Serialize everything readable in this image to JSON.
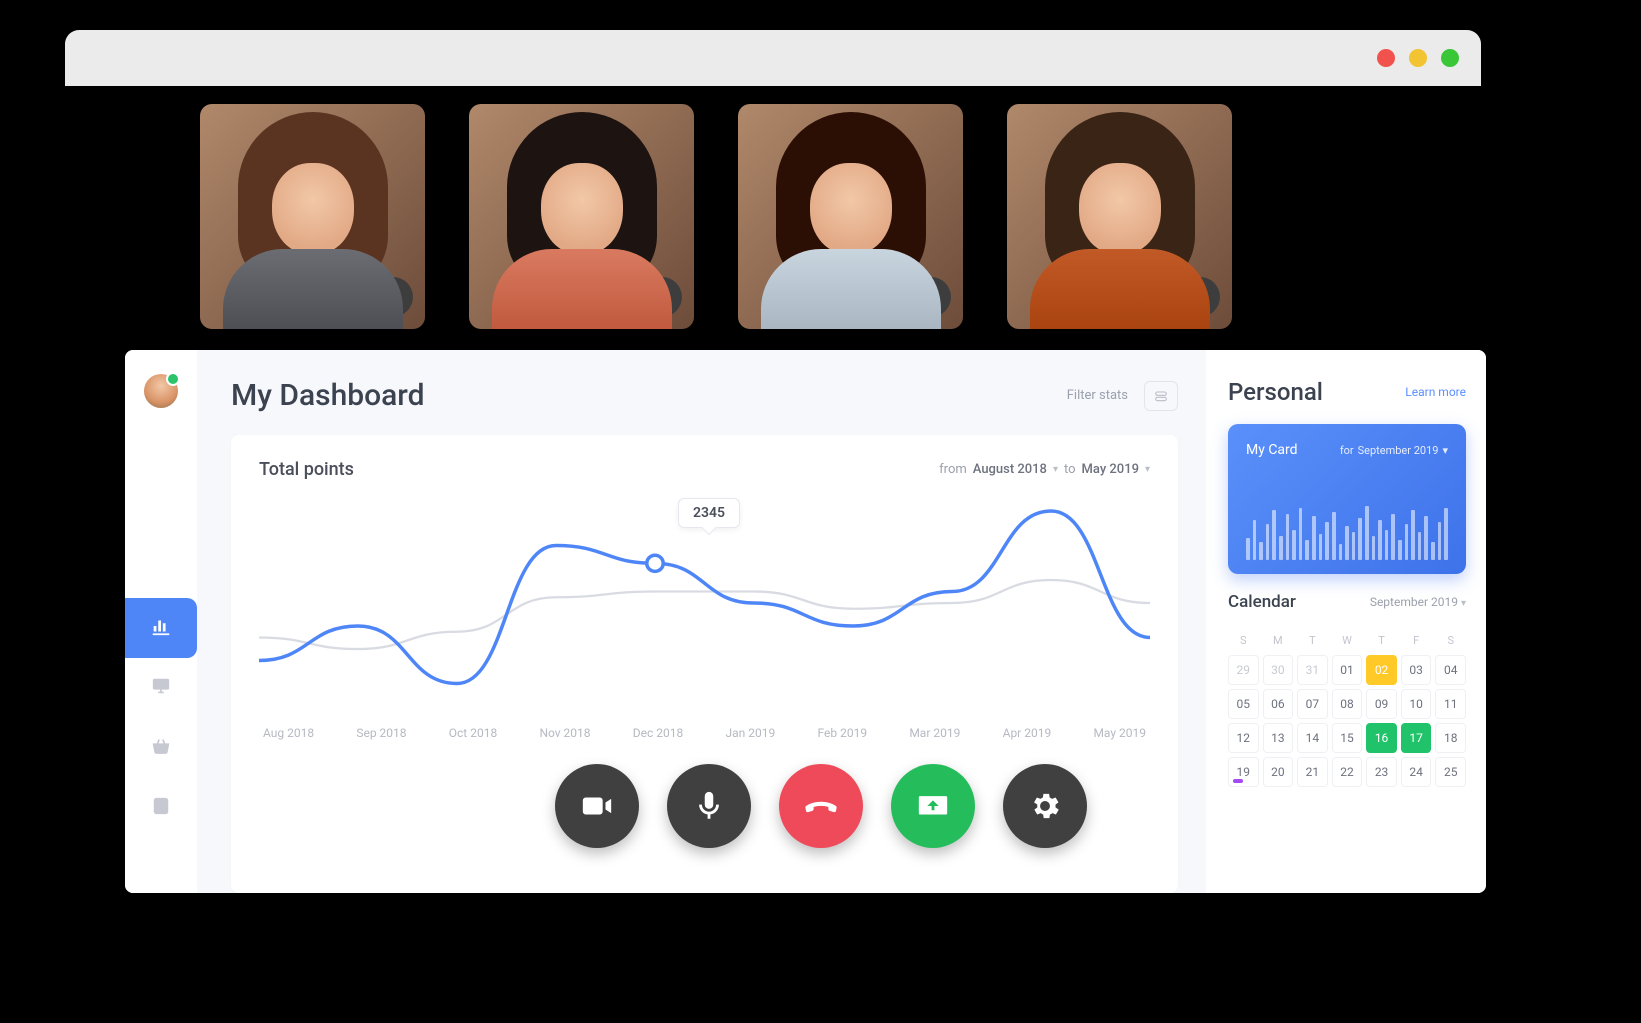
{
  "window": {
    "controls": [
      "close",
      "minimize",
      "maximize"
    ]
  },
  "participants": [
    {
      "name": "participant-1",
      "mic": "unmuted"
    },
    {
      "name": "participant-2",
      "mic": "unmuted"
    },
    {
      "name": "participant-3",
      "mic": "unmuted"
    },
    {
      "name": "participant-4",
      "mic": "unmuted"
    }
  ],
  "call_controls": {
    "video": "video-icon",
    "mic": "microphone-icon",
    "hangup": "phone-hangup-icon",
    "share": "screen-share-icon",
    "settings": "gear-icon"
  },
  "sidebar": {
    "items": [
      {
        "icon": "bar-chart-icon",
        "active": true
      },
      {
        "icon": "presentation-icon",
        "active": false
      },
      {
        "icon": "basket-icon",
        "active": false
      },
      {
        "icon": "note-icon",
        "active": false
      }
    ]
  },
  "dashboard": {
    "title": "My Dashboard",
    "filter_label": "Filter stats",
    "points": {
      "title": "Total points",
      "from_label": "from",
      "from_value": "August 2018",
      "to_label": "to",
      "to_value": "May 2019",
      "tooltip_value": "2345",
      "x_labels": [
        "Aug 2018",
        "Sep 2018",
        "Oct 2018",
        "Nov 2018",
        "Dec 2018",
        "Jan 2019",
        "Feb 2019",
        "Mar 2019",
        "Apr 2019",
        "May 2019"
      ]
    }
  },
  "personal": {
    "title": "Personal",
    "learn_label": "Learn more",
    "card": {
      "title": "My Card",
      "for_label": "for",
      "for_value": "September 2019"
    },
    "calendar": {
      "title": "Calendar",
      "month": "September 2019",
      "dow": [
        "S",
        "M",
        "T",
        "W",
        "T",
        "F",
        "S"
      ],
      "rows": [
        [
          {
            "d": "29",
            "muted": true
          },
          {
            "d": "30",
            "muted": true
          },
          {
            "d": "31",
            "muted": true
          },
          {
            "d": "01"
          },
          {
            "d": "02",
            "hl": "yellow"
          },
          {
            "d": "03"
          },
          {
            "d": "04"
          }
        ],
        [
          {
            "d": "05"
          },
          {
            "d": "06"
          },
          {
            "d": "07"
          },
          {
            "d": "08"
          },
          {
            "d": "09"
          },
          {
            "d": "10"
          },
          {
            "d": "11"
          }
        ],
        [
          {
            "d": "12"
          },
          {
            "d": "13"
          },
          {
            "d": "14"
          },
          {
            "d": "15"
          },
          {
            "d": "16",
            "hl": "green"
          },
          {
            "d": "17",
            "hl": "green"
          },
          {
            "d": "18"
          }
        ],
        [
          {
            "d": "19",
            "dot": true
          },
          {
            "d": "20"
          },
          {
            "d": "21"
          },
          {
            "d": "22"
          },
          {
            "d": "23"
          },
          {
            "d": "24"
          },
          {
            "d": "25"
          }
        ]
      ]
    }
  },
  "chart_data": {
    "type": "line",
    "title": "Total points",
    "xlabel": "",
    "ylabel": "",
    "categories": [
      "Aug 2018",
      "Sep 2018",
      "Oct 2018",
      "Nov 2018",
      "Dec 2018",
      "Jan 2019",
      "Feb 2019",
      "Mar 2019",
      "Apr 2019",
      "May 2019"
    ],
    "series": [
      {
        "name": "primary",
        "values": [
          1500,
          1800,
          1300,
          2500,
          2345,
          2000,
          1800,
          2100,
          2800,
          1700
        ]
      },
      {
        "name": "secondary",
        "values": [
          1700,
          1600,
          1750,
          2050,
          2100,
          2100,
          1950,
          2000,
          2200,
          2000
        ]
      }
    ],
    "highlight": {
      "index": 4,
      "value": 2345
    },
    "ylim": [
      1000,
      3000
    ],
    "card_spark": [
      22,
      40,
      18,
      36,
      50,
      24,
      46,
      30,
      52,
      20,
      44,
      26,
      38,
      48,
      16,
      34,
      28,
      42,
      54,
      24,
      40,
      30,
      46,
      20,
      36,
      50,
      28,
      44,
      18,
      38,
      52
    ]
  }
}
